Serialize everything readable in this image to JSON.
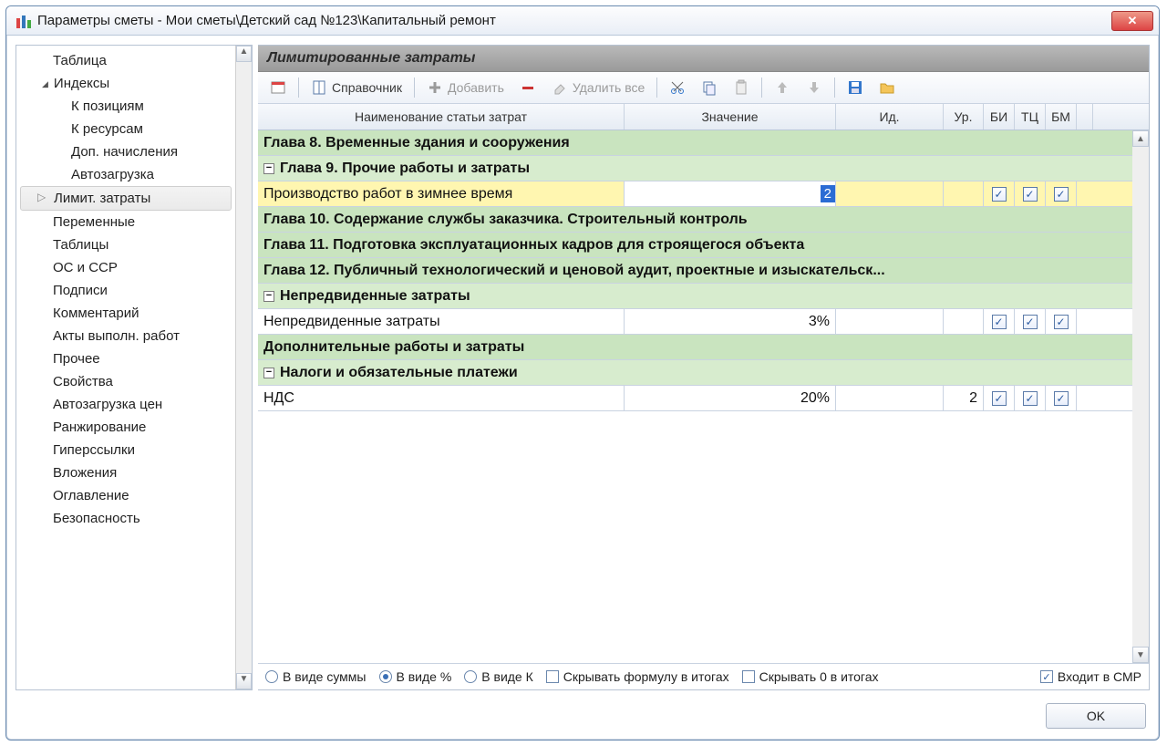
{
  "window": {
    "title": "Параметры сметы - Мои сметы\\Детский сад №123\\Капитальный ремонт"
  },
  "tree": {
    "items": [
      {
        "label": "Таблица",
        "kind": "level0"
      },
      {
        "label": "Индексы",
        "kind": "root expander"
      },
      {
        "label": "К позициям",
        "kind": "level1"
      },
      {
        "label": "К ресурсам",
        "kind": "level1"
      },
      {
        "label": "Доп. начисления",
        "kind": "level1"
      },
      {
        "label": "Автозагрузка",
        "kind": "level1"
      },
      {
        "label": "Лимит. затраты",
        "kind": "root",
        "selected": true
      },
      {
        "label": "Переменные",
        "kind": "level0"
      },
      {
        "label": "Таблицы",
        "kind": "level0"
      },
      {
        "label": "ОС и ССР",
        "kind": "level0"
      },
      {
        "label": "Подписи",
        "kind": "level0"
      },
      {
        "label": "Комментарий",
        "kind": "level0"
      },
      {
        "label": "Акты выполн. работ",
        "kind": "level0"
      },
      {
        "label": "Прочее",
        "kind": "level0"
      },
      {
        "label": "Свойства",
        "kind": "level0"
      },
      {
        "label": "Автозагрузка цен",
        "kind": "level0"
      },
      {
        "label": "Ранжирование",
        "kind": "level0"
      },
      {
        "label": "Гиперссылки",
        "kind": "level0"
      },
      {
        "label": "Вложения",
        "kind": "level0"
      },
      {
        "label": "Оглавление",
        "kind": "level0"
      },
      {
        "label": "Безопасность",
        "kind": "level0"
      }
    ]
  },
  "panel": {
    "title": "Лимитированные затраты"
  },
  "toolbar": {
    "reference": "Справочник",
    "add": "Добавить",
    "delete_all": "Удалить все"
  },
  "columns": {
    "name": "Наименование статьи затрат",
    "value": "Значение",
    "id": "Ид.",
    "level": "Ур.",
    "bi": "БИ",
    "tc": "ТЦ",
    "bm": "БМ"
  },
  "rows": [
    {
      "type": "header",
      "name": "Глава 8. Временные здания и сооружения"
    },
    {
      "type": "sub",
      "name": "Глава 9. Прочие работы и затраты",
      "expand": "-"
    },
    {
      "type": "active",
      "name": "Производство работ в зимнее время",
      "value": "2",
      "bi": true,
      "tc": true,
      "bm": true
    },
    {
      "type": "header",
      "name": "Глава 10. Содержание службы заказчика. Строительный контроль"
    },
    {
      "type": "header",
      "name": "Глава 11. Подготовка эксплуатационных кадров для строящегося объекта"
    },
    {
      "type": "header",
      "name": "Глава 12. Публичный технологический и ценовой аудит, проектные и изыскательск..."
    },
    {
      "type": "sub",
      "name": "Непредвиденные затраты",
      "expand": "-"
    },
    {
      "type": "data",
      "name": "Непредвиденные затраты",
      "value": "3%",
      "bi": true,
      "tc": true,
      "bm": true
    },
    {
      "type": "header",
      "name": "Дополнительные работы и затраты"
    },
    {
      "type": "sub",
      "name": "Налоги и обязательные платежи",
      "expand": "-"
    },
    {
      "type": "data",
      "name": "НДС",
      "value": "20%",
      "ur": "2",
      "bi": true,
      "tc": true,
      "bm": true
    }
  ],
  "footer": {
    "as_sum": "В виде суммы",
    "as_pct": "В виде %",
    "as_k": "В виде К",
    "hide_formula": "Скрывать формулу в итогах",
    "hide_zero": "Скрывать 0 в итогах",
    "in_smr": "Входит в СМР",
    "selected": "as_pct",
    "in_smr_checked": true
  },
  "buttons": {
    "ok": "OK"
  }
}
